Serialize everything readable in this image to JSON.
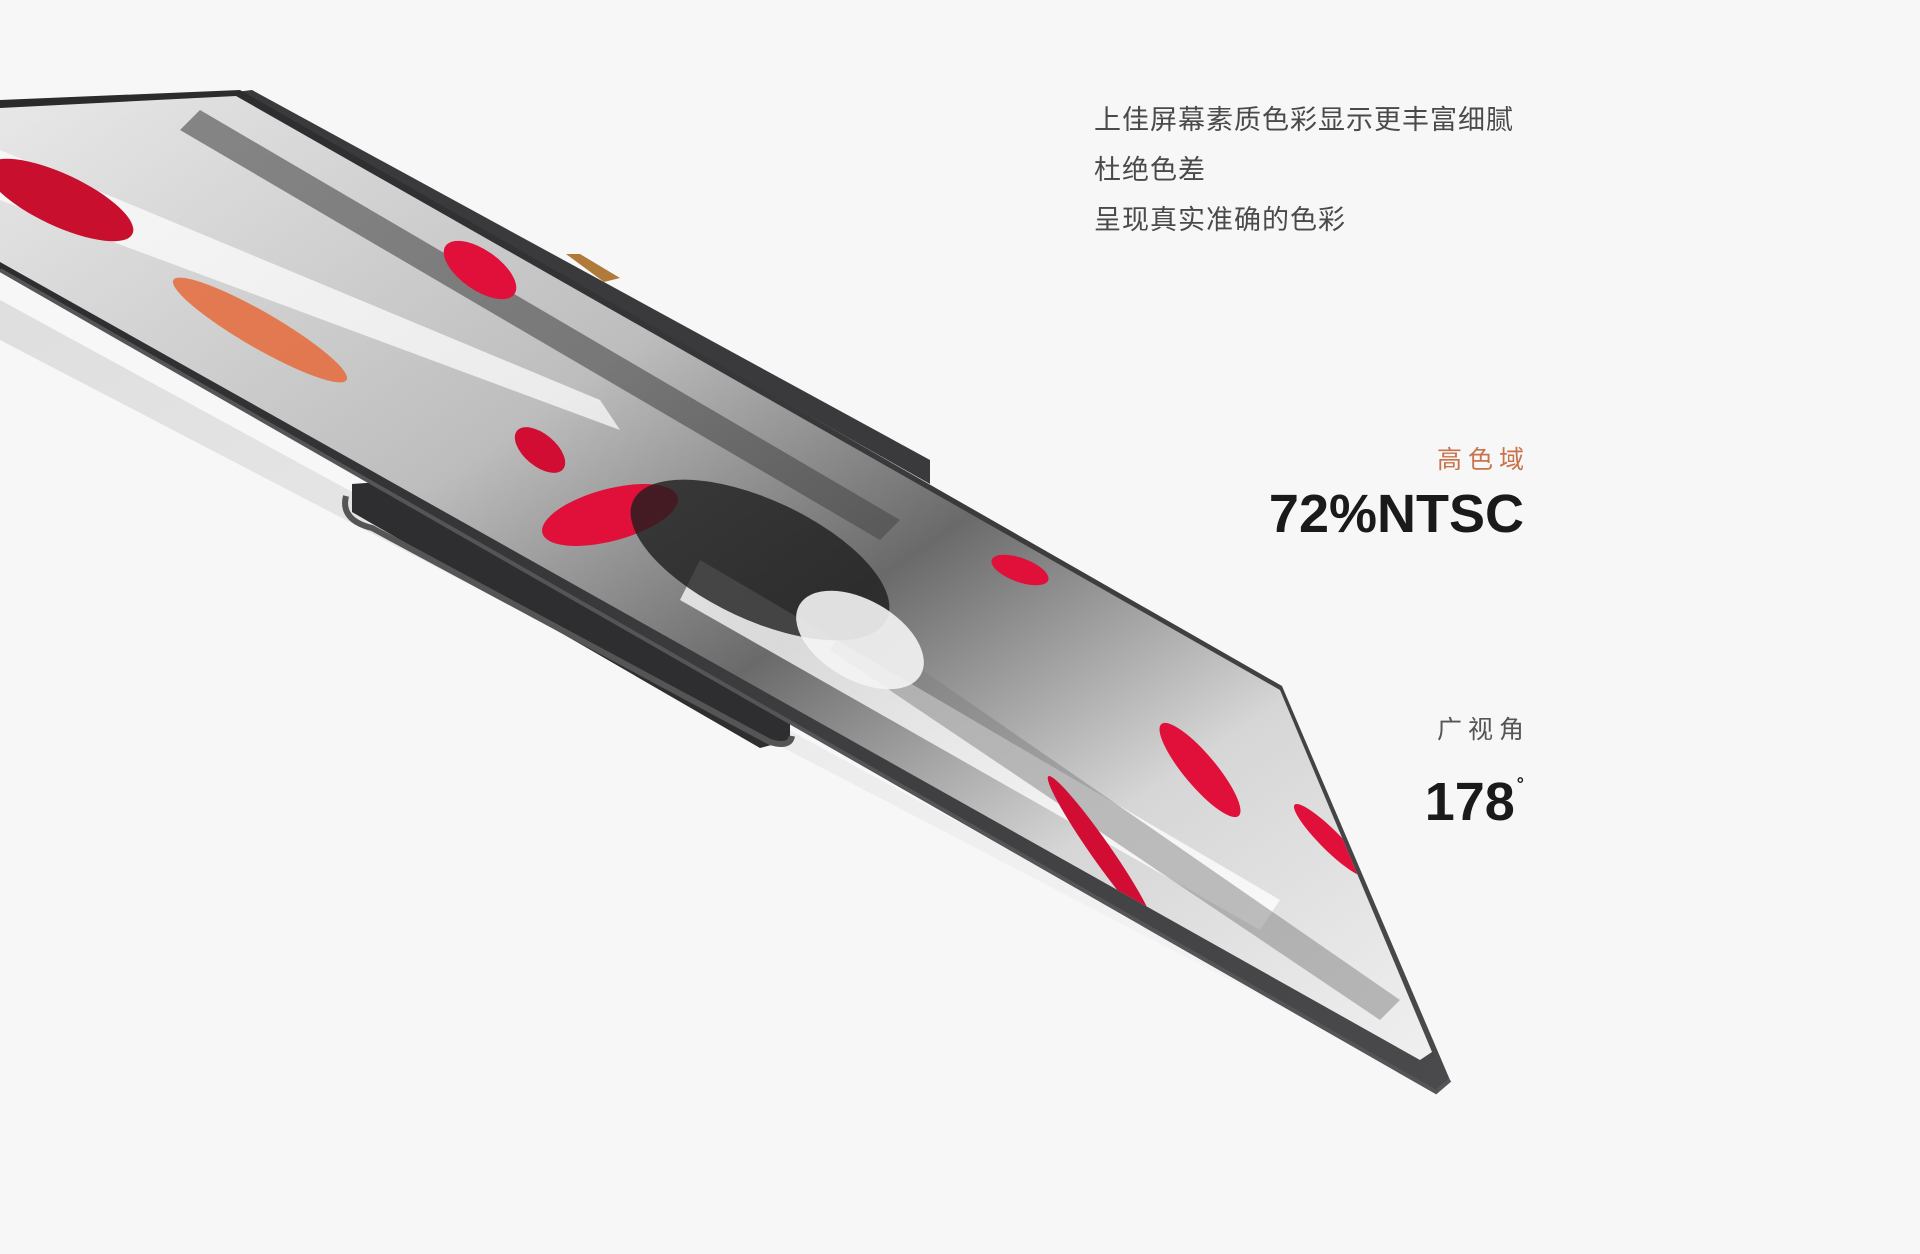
{
  "intro": {
    "lines": [
      "上佳屏幕素质色彩显示更丰富细腻",
      "杜绝色差",
      "呈现真实准确的色彩"
    ]
  },
  "specs": {
    "gamut": {
      "label": "高色域",
      "value": "72%NTSC",
      "label_color": "#c8734a"
    },
    "angle": {
      "label": "广视角",
      "value": "178",
      "unit": "°",
      "label_color": "#555555"
    }
  },
  "colors": {
    "background": "#f7f7f8",
    "bezel": "#3a3a3c",
    "accent_red": "#e0103a",
    "value_text": "#1a1a1a"
  }
}
